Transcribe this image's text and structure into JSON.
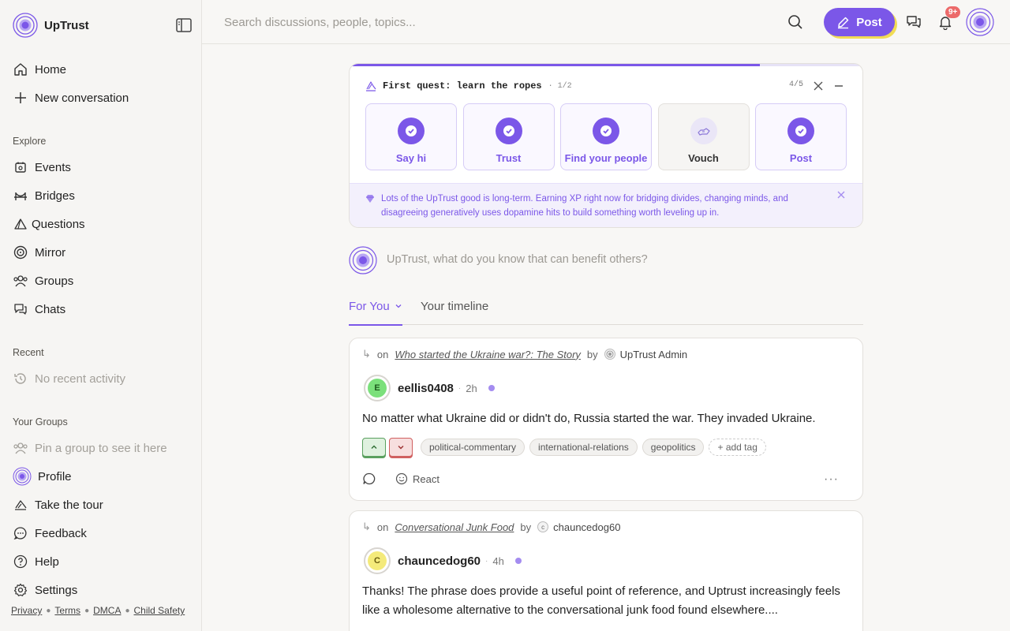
{
  "app": {
    "name": "UpTrust"
  },
  "sidebar": {
    "primary": [
      {
        "label": "Home",
        "icon": "home-icon"
      },
      {
        "label": "New conversation",
        "icon": "plus-icon"
      }
    ],
    "explore_label": "Explore",
    "explore": [
      {
        "label": "Events",
        "icon": "calendar-icon"
      },
      {
        "label": "Bridges",
        "icon": "bridge-icon"
      },
      {
        "label": "Questions",
        "icon": "question-triangle-icon"
      },
      {
        "label": "Mirror",
        "icon": "target-icon"
      },
      {
        "label": "Groups",
        "icon": "people-icon"
      },
      {
        "label": "Chats",
        "icon": "chat-icon"
      }
    ],
    "recent_label": "Recent",
    "recent_empty": "No recent activity",
    "groups_label": "Your Groups",
    "groups_empty": "Pin a group to see it here",
    "bottom": [
      {
        "label": "Profile",
        "icon": "profile-avatar-icon"
      },
      {
        "label": "Take the tour",
        "icon": "tour-icon"
      },
      {
        "label": "Feedback",
        "icon": "feedback-icon"
      },
      {
        "label": "Help",
        "icon": "help-icon"
      },
      {
        "label": "Settings",
        "icon": "gear-icon"
      }
    ],
    "footer": [
      "Privacy",
      "Terms",
      "DMCA",
      "Child Safety"
    ]
  },
  "topbar": {
    "search_placeholder": "Search discussions, people, topics...",
    "post_label": "Post",
    "notifications_badge": "9+"
  },
  "quest": {
    "title": "First quest: learn the ropes",
    "step": "1/2",
    "count": "4/5",
    "progress": 0.8,
    "steps": [
      {
        "label": "Say hi",
        "done": true
      },
      {
        "label": "Trust",
        "done": true
      },
      {
        "label": "Find your people",
        "done": true
      },
      {
        "label": "Vouch",
        "done": false
      },
      {
        "label": "Post",
        "done": true
      }
    ],
    "note": "Lots of the UpTrust good is long-term. Earning XP right now for bridging divides, changing minds, and disagreeing generatively uses dopamine hits to build something worth leveling up in."
  },
  "composer": {
    "prompt": "UpTrust, what do you know that can benefit others?"
  },
  "tabs": [
    {
      "label": "For You"
    },
    {
      "label": "Your timeline"
    }
  ],
  "posts": [
    {
      "on": "on",
      "thread": "Who started the Ukraine war?: The Story",
      "by": "by",
      "thread_author": "UpTrust Admin",
      "user": "eellis0408",
      "initial": "E",
      "avatar_color": "#7be07b",
      "age": "2h",
      "text": "No matter what Ukraine did or didn't do, Russia started the war. They invaded Ukraine.",
      "tags": [
        "political-commentary",
        "international-relations",
        "geopolitics"
      ],
      "add_tag": "+ add tag",
      "react": "React"
    },
    {
      "on": "on",
      "thread": "Conversational Junk Food",
      "by": "by",
      "thread_author": "chauncedog60",
      "thread_author_initial": "c",
      "user": "chauncedog60",
      "initial": "C",
      "avatar_color": "#f4ea7a",
      "age": "4h",
      "text": "Thanks! The phrase does provide a useful point of reference, and Uptrust increasingly feels like a wholesome alternative to the conversational junk food found elsewhere...."
    }
  ],
  "colors": {
    "accent": "#7b57e8",
    "highlight": "#f1dc55",
    "badge": "#ec6a6a"
  }
}
